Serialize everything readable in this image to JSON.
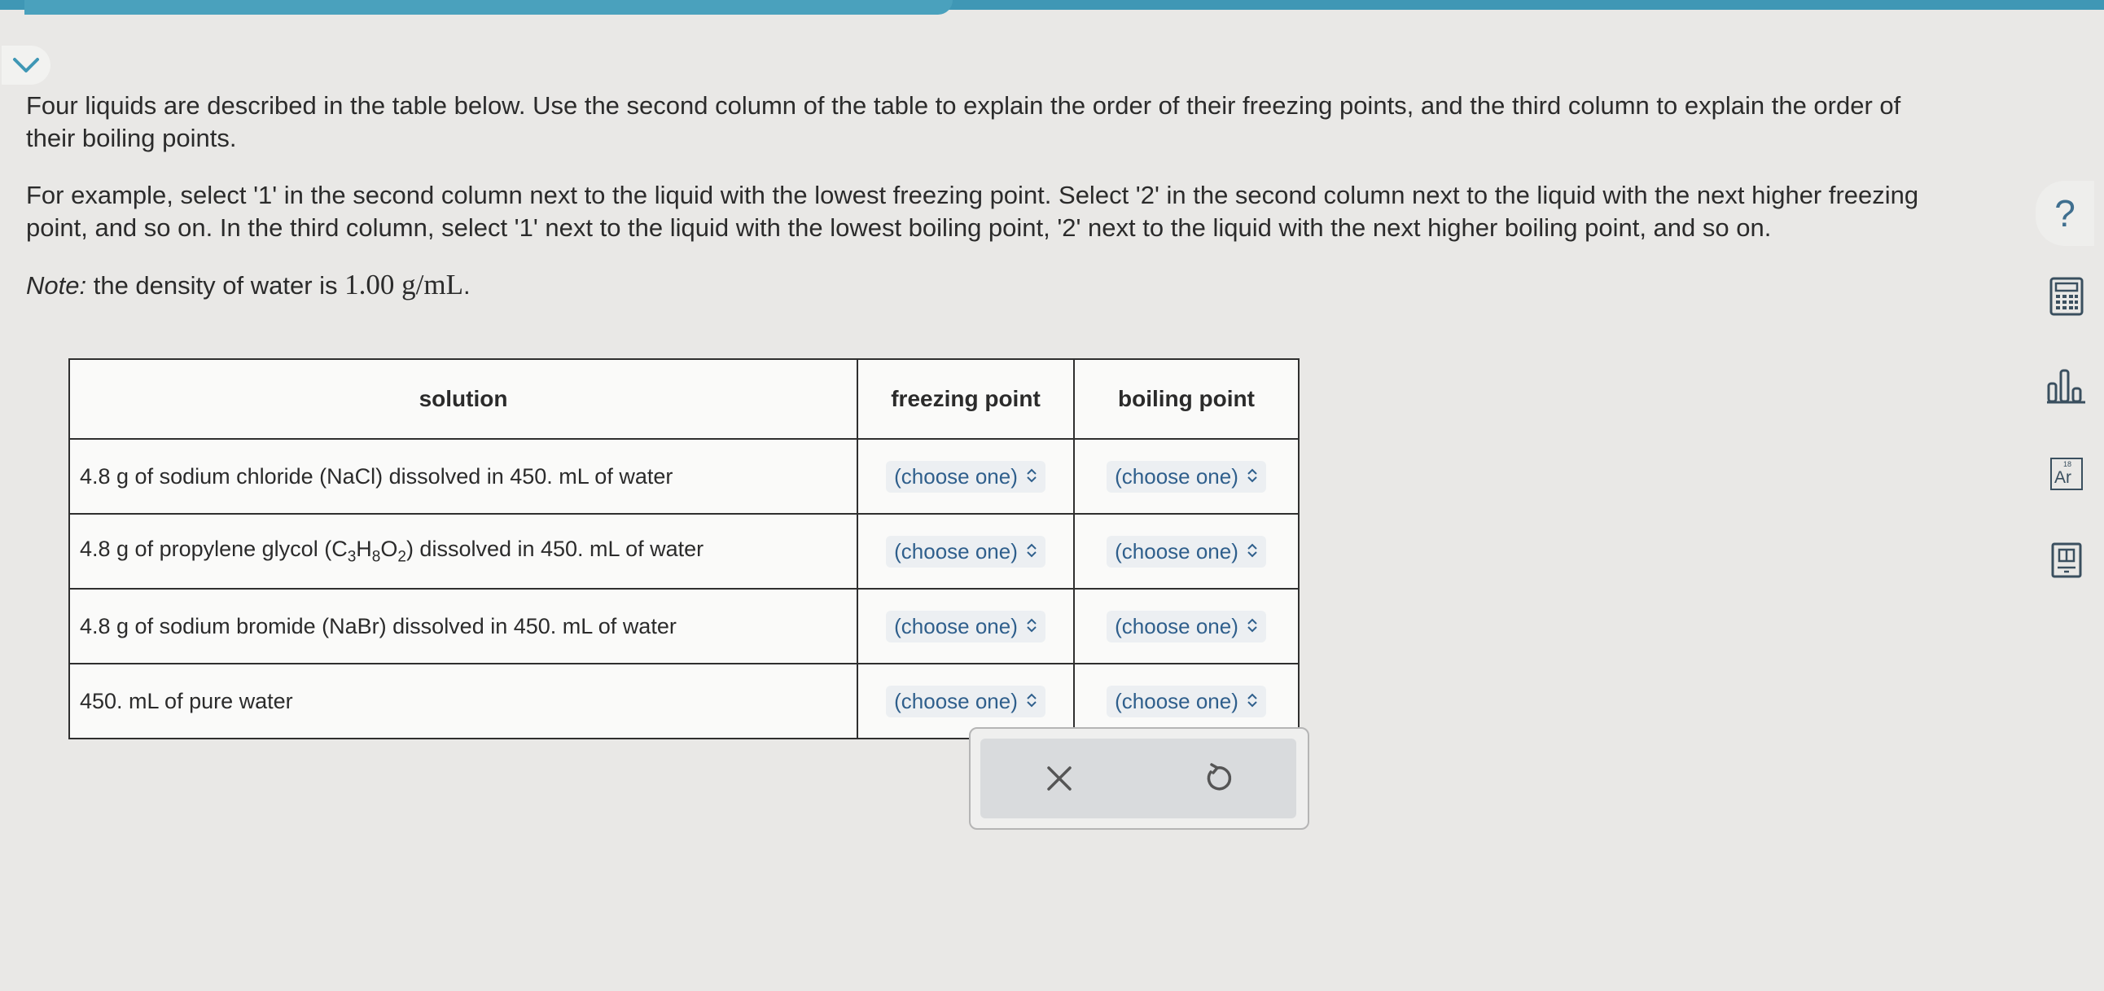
{
  "instructions": {
    "p1": "Four liquids are described in the table below. Use the second column of the table to explain the order of their freezing points, and the third column to explain the order of their boiling points.",
    "p2": "For example, select '1' in the second column next to the liquid with the lowest freezing point. Select '2' in the second column next to the liquid with the next higher freezing point, and so on. In the third column, select '1' next to the liquid with the lowest boiling point, '2' next to the liquid with the next higher boiling point, and so on.",
    "note_label": "Note:",
    "note_text": " the density of water is ",
    "note_value": "1.00 g/mL",
    "note_end": "."
  },
  "table": {
    "headers": {
      "solution": "solution",
      "freezing": "freezing point",
      "boiling": "boiling point"
    },
    "rows": [
      {
        "pre": "4.8 g of sodium chloride (NaCl) dissolved in 450. mL of water",
        "formula": null,
        "post": "",
        "fp": "(choose one)",
        "bp": "(choose one)"
      },
      {
        "pre": "4.8 g of propylene glycol (",
        "formula": [
          "C",
          "3",
          "H",
          "8",
          "O",
          "2"
        ],
        "post": ") dissolved in 450. mL of water",
        "fp": "(choose one)",
        "bp": "(choose one)"
      },
      {
        "pre": "4.8 g of sodium bromide (NaBr) dissolved in 450. mL of water",
        "formula": null,
        "post": "",
        "fp": "(choose one)",
        "bp": "(choose one)"
      },
      {
        "pre": "450. mL of pure water",
        "formula": null,
        "post": "",
        "fp": "(choose one)",
        "bp": "(choose one)"
      }
    ]
  },
  "side_tools": {
    "help": "?",
    "periodic_table_symbol": "Ar"
  },
  "icons": [
    "chevron-down-icon",
    "close-icon",
    "undo-icon",
    "help-icon",
    "calculator-icon",
    "bar-chart-icon",
    "periodic-table-icon",
    "book-icon"
  ],
  "colors": {
    "accent": "#3f97b5",
    "link": "#2f5f8c"
  }
}
